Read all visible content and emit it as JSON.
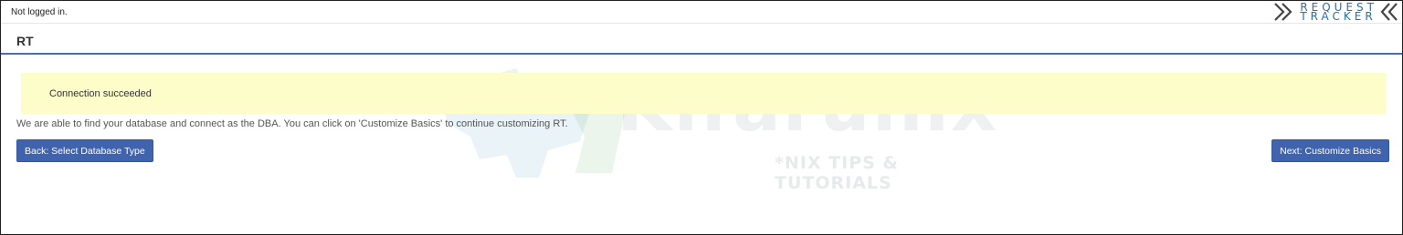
{
  "header": {
    "login_status": "Not logged in.",
    "logo_line1": "REQUEST",
    "logo_line2": "TRACKER"
  },
  "page": {
    "title": "RT"
  },
  "alert": {
    "message": "Connection succeeded"
  },
  "content": {
    "description": "We are able to find your database and connect as the DBA. You can click on 'Customize Basics' to continue customizing RT."
  },
  "buttons": {
    "back_label": "Back: Select Database Type",
    "next_label": "Next: Customize Basics"
  },
  "watermark": {
    "brand": "Kifarunix",
    "tagline": "*NIX TIPS & TUTORIALS"
  },
  "colors": {
    "accent": "#3f63ad",
    "alert_bg": "#fdfdc9",
    "logo": "#2b6fa6"
  }
}
